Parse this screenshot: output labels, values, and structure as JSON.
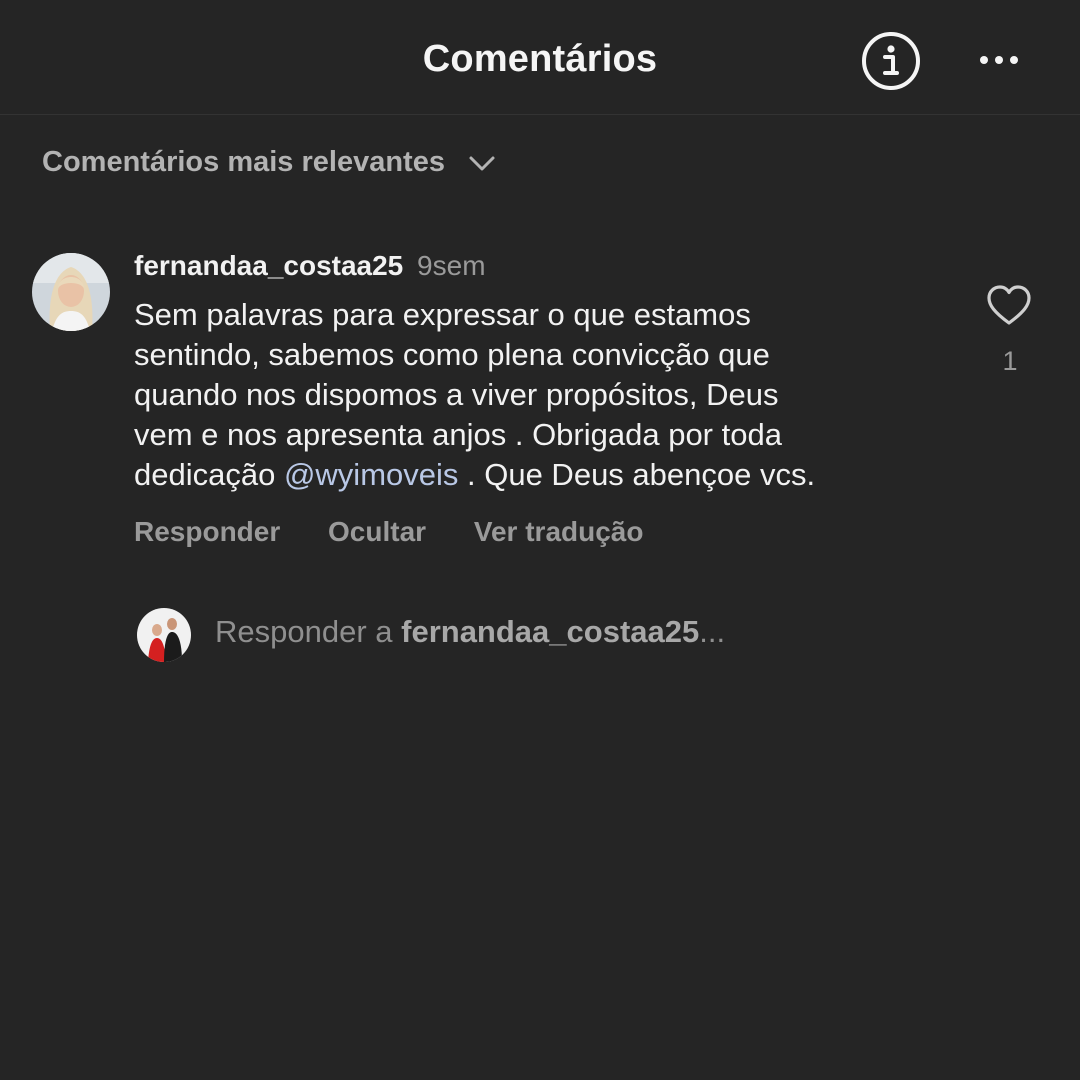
{
  "header": {
    "title": "Comentários",
    "info_icon": "info-circle-icon",
    "more_icon": "more-horizontal-icon"
  },
  "sort": {
    "label": "Comentários mais relevantes",
    "icon": "chevron-down-icon"
  },
  "comment": {
    "username": "fernandaa_costaa25",
    "time": "9sem",
    "lines": [
      "Sem palavras para expressar o que estamos",
      "sentindo,  sabemos como plena convicção que",
      "quando nos dispomos a viver propósitos, Deus",
      "vem e nos apresenta anjos . Obrigada por toda"
    ],
    "last_line_prefix": "dedicação ",
    "mention": "@wyimoveis",
    "last_line_suffix": " . Que Deus abençoe vcs.",
    "like_count": "1",
    "like_icon": "heart-outline-icon",
    "actions": {
      "reply": "Responder",
      "hide": "Ocultar",
      "translate": "Ver tradução"
    }
  },
  "reply_box": {
    "prefix": "Responder a ",
    "username": "fernandaa_costaa25",
    "ellipsis": "..."
  },
  "colors": {
    "background": "#252525",
    "text": "#f2f2f2",
    "muted": "#9a9a9a",
    "mention": "#b9c8e6"
  }
}
